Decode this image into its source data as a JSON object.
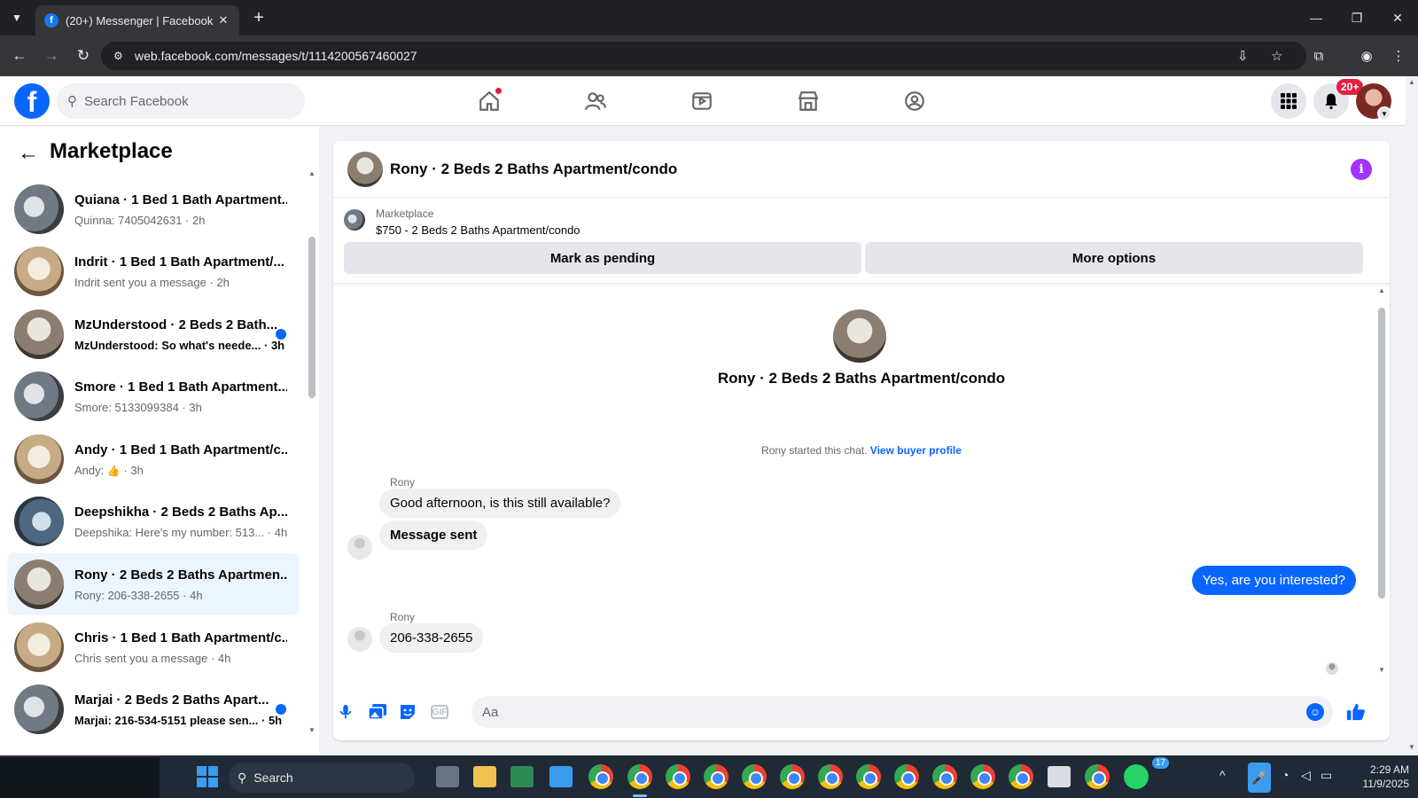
{
  "browser": {
    "tab_title": "(20+) Messenger | Facebook",
    "favicon": "f",
    "url": "web.facebook.com/messages/t/1114200567460027"
  },
  "fb": {
    "search_placeholder": "Search Facebook",
    "notification_badge": "20+",
    "nav_icons": [
      "home-icon",
      "friends-icon",
      "video-icon",
      "marketplace-icon",
      "groups-icon"
    ]
  },
  "sidebar": {
    "title": "Marketplace",
    "conversations": [
      {
        "name": "Quiana · 1 Bed 1 Bath Apartment...",
        "snippet": "Quinna: 7405042631 · 2h",
        "unread": false
      },
      {
        "name": "Indrit · 1 Bed 1 Bath Apartment/...",
        "snippet": "Indrit sent you a message · 2h",
        "unread": false
      },
      {
        "name": "MzUnderstood · 2 Beds 2 Bath...",
        "snippet": "MzUnderstood: So what's neede... · 3h",
        "unread": true
      },
      {
        "name": "Smore · 1 Bed 1 Bath Apartment...",
        "snippet": "Smore: 5133099384 · 3h",
        "unread": false
      },
      {
        "name": "Andy · 1 Bed 1 Bath Apartment/c...",
        "snippet_prefix": "Andy: ",
        "snippet_suffix": " · 3h",
        "unread": false
      },
      {
        "name": "Deepshikha · 2 Beds 2 Baths Ap...",
        "snippet": "Deepshika: Here's my number: 513... · 4h",
        "unread": false
      },
      {
        "name": "Rony · 2 Beds 2 Baths Apartmen...",
        "snippet": "Rony: 206-338-2655 · 4h",
        "unread": false,
        "active": true
      },
      {
        "name": "Chris · 1 Bed 1 Bath Apartment/c...",
        "snippet": "Chris sent you a message · 4h",
        "unread": false
      },
      {
        "name": "Marjai · 2 Beds 2 Baths Apart...",
        "snippet": "Marjai: 216-534-5151 please sen... · 5h",
        "unread": true
      }
    ]
  },
  "chat": {
    "title": "Rony · 2 Beds 2 Baths Apartment/condo",
    "marketplace_label": "Marketplace",
    "listing": "$750 - 2 Beds 2 Baths Apartment/condo",
    "mark_pending": "Mark as pending",
    "more_options": "More options",
    "hero_title": "Rony · 2 Beds 2 Baths Apartment/condo",
    "started_text": "Rony started this chat.",
    "view_profile": "View buyer profile",
    "messages": [
      {
        "sender": "Rony",
        "text": "Good afternoon, is this still available?",
        "direction": "in"
      },
      {
        "text": "Message sent",
        "direction": "in"
      },
      {
        "text": "Yes, are you interested?",
        "direction": "out"
      },
      {
        "sender": "Rony",
        "text": "206-338-2655",
        "direction": "in"
      }
    ],
    "composer_placeholder": "Aa"
  },
  "taskbar": {
    "search_label": "Search",
    "whatsapp_badge": "17",
    "time": "2:29 AM",
    "date": "11/9/2025"
  },
  "colors": {
    "accent": "#0866ff",
    "bubble_in": "#f0f0f0",
    "active_conv": "#ebf5ff",
    "info": "#a033ff",
    "badge": "#e41e3f"
  }
}
